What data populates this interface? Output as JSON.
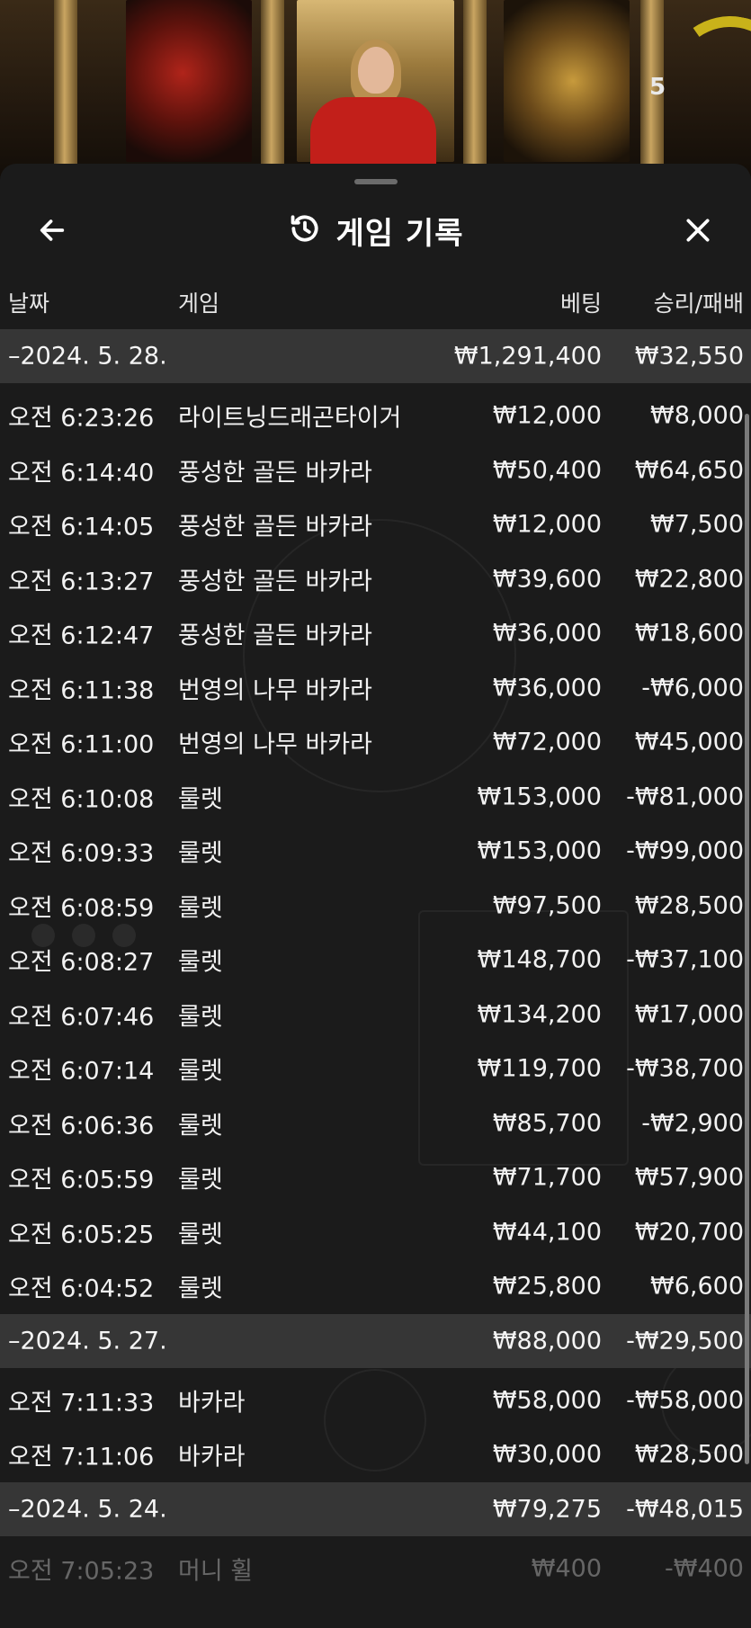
{
  "timer": {
    "value": "5"
  },
  "header": {
    "title": "게임 기록",
    "back_icon": "back-arrow-icon",
    "history_icon": "history-clock-icon",
    "close_icon": "close-icon"
  },
  "columns": {
    "date": "날짜",
    "game": "게임",
    "bet": "베팅",
    "winloss": "승리/패배"
  },
  "groups": [
    {
      "date": "–2024. 5. 28.",
      "bet_total": "₩1,291,400",
      "winloss_total": "₩32,550",
      "rows": [
        {
          "time": "오전 6:23:26",
          "game": "라이트닝드래곤타이거",
          "bet": "₩12,000",
          "winloss": "₩8,000"
        },
        {
          "time": "오전 6:14:40",
          "game": "풍성한 골든 바카라",
          "bet": "₩50,400",
          "winloss": "₩64,650"
        },
        {
          "time": "오전 6:14:05",
          "game": "풍성한 골든 바카라",
          "bet": "₩12,000",
          "winloss": "₩7,500"
        },
        {
          "time": "오전 6:13:27",
          "game": "풍성한 골든 바카라",
          "bet": "₩39,600",
          "winloss": "₩22,800"
        },
        {
          "time": "오전 6:12:47",
          "game": "풍성한 골든 바카라",
          "bet": "₩36,000",
          "winloss": "₩18,600"
        },
        {
          "time": "오전 6:11:38",
          "game": "번영의 나무 바카라",
          "bet": "₩36,000",
          "winloss": "-₩6,000"
        },
        {
          "time": "오전 6:11:00",
          "game": "번영의 나무 바카라",
          "bet": "₩72,000",
          "winloss": "₩45,000"
        },
        {
          "time": "오전 6:10:08",
          "game": "룰렛",
          "bet": "₩153,000",
          "winloss": "-₩81,000"
        },
        {
          "time": "오전 6:09:33",
          "game": "룰렛",
          "bet": "₩153,000",
          "winloss": "-₩99,000"
        },
        {
          "time": "오전 6:08:59",
          "game": "룰렛",
          "bet": "₩97,500",
          "winloss": "₩28,500"
        },
        {
          "time": "오전 6:08:27",
          "game": "룰렛",
          "bet": "₩148,700",
          "winloss": "-₩37,100"
        },
        {
          "time": "오전 6:07:46",
          "game": "룰렛",
          "bet": "₩134,200",
          "winloss": "₩17,000"
        },
        {
          "time": "오전 6:07:14",
          "game": "룰렛",
          "bet": "₩119,700",
          "winloss": "-₩38,700"
        },
        {
          "time": "오전 6:06:36",
          "game": "룰렛",
          "bet": "₩85,700",
          "winloss": "-₩2,900"
        },
        {
          "time": "오전 6:05:59",
          "game": "룰렛",
          "bet": "₩71,700",
          "winloss": "₩57,900"
        },
        {
          "time": "오전 6:05:25",
          "game": "룰렛",
          "bet": "₩44,100",
          "winloss": "₩20,700"
        },
        {
          "time": "오전 6:04:52",
          "game": "룰렛",
          "bet": "₩25,800",
          "winloss": "₩6,600"
        }
      ]
    },
    {
      "date": "–2024. 5. 27.",
      "bet_total": "₩88,000",
      "winloss_total": "-₩29,500",
      "rows": [
        {
          "time": "오전 7:11:33",
          "game": "바카라",
          "bet": "₩58,000",
          "winloss": "-₩58,000"
        },
        {
          "time": "오전 7:11:06",
          "game": "바카라",
          "bet": "₩30,000",
          "winloss": "₩28,500"
        }
      ]
    },
    {
      "date": "–2024. 5. 24.",
      "bet_total": "₩79,275",
      "winloss_total": "-₩48,015",
      "rows": [
        {
          "time": "오전 7:05:23",
          "game": "머니 휠",
          "bet": "₩400",
          "winloss": "-₩400"
        }
      ]
    }
  ]
}
